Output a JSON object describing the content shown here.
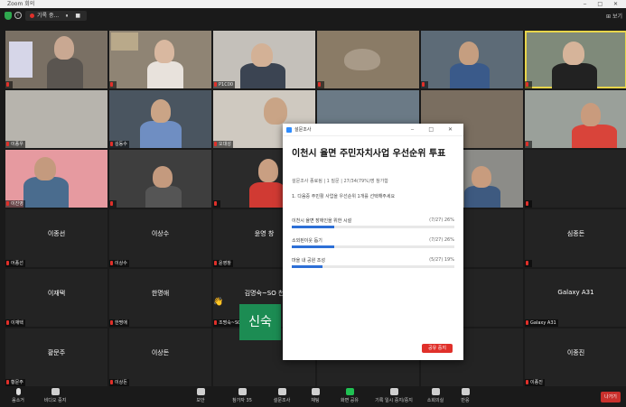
{
  "window": {
    "title": "Zoom 회의",
    "controls": "‒ □ ✕"
  },
  "topbar": {
    "recording_label": "기록 중...",
    "recording_controls": "⏸ ■",
    "view_label": "⊞ 보기"
  },
  "participants": [
    {
      "name": "",
      "label": "",
      "video": true
    },
    {
      "name": "",
      "label": "",
      "video": true
    },
    {
      "name": "",
      "label": "P1C00",
      "video": true
    },
    {
      "name": "",
      "label": "",
      "video": true
    },
    {
      "name": "",
      "label": "",
      "video": true
    },
    {
      "name": "",
      "label": "",
      "video": true
    },
    {
      "name": "",
      "label": "이종우",
      "video": true
    },
    {
      "name": "",
      "label": "김동수",
      "video": true
    },
    {
      "name": "",
      "label": "오대성",
      "video": true
    },
    {
      "name": "",
      "label": "",
      "video": true
    },
    {
      "name": "",
      "label": "",
      "video": true
    },
    {
      "name": "",
      "label": "",
      "video": true
    },
    {
      "name": "",
      "label": "이진영",
      "video": true
    },
    {
      "name": "",
      "label": "",
      "video": true
    },
    {
      "name": "",
      "label": "",
      "video": true
    },
    {
      "name": "",
      "label": "",
      "video": true
    },
    {
      "name": "",
      "label": "",
      "video": true
    },
    {
      "name": "",
      "label": "",
      "video": true
    },
    {
      "name": "이종선",
      "label": "어종선",
      "video": false
    },
    {
      "name": "이상수",
      "label": "이상수",
      "video": false
    },
    {
      "name": "윤영 창",
      "label": "윤영창",
      "video": false
    },
    {
      "name": "",
      "label": "",
      "video": false
    },
    {
      "name": "",
      "label": "",
      "video": false
    },
    {
      "name": "심종돈",
      "label": "",
      "video": false
    },
    {
      "name": "이재택",
      "label": "이재택",
      "video": false
    },
    {
      "name": "한명애",
      "label": "한명애",
      "video": false
    },
    {
      "name": "김명숙~SO 천",
      "label": "조명숙~SO 천호주",
      "video": false
    },
    {
      "name": "",
      "label": "",
      "video": false
    },
    {
      "name": "",
      "label": "",
      "video": false
    },
    {
      "name": "Galaxy A31",
      "label": "Galaxy A31",
      "video": false
    },
    {
      "name": "황문주",
      "label": "황문주",
      "video": false
    },
    {
      "name": "이상돈",
      "label": "이상돈",
      "video": false
    },
    {
      "name": "",
      "label": "",
      "video": false
    },
    {
      "name": "",
      "label": "",
      "video": false
    },
    {
      "name": "",
      "label": "",
      "video": false
    },
    {
      "name": "이종진",
      "label": "이종진",
      "video": false
    }
  ],
  "extra_tile_text": "신숙",
  "wave_emoji": "👋",
  "poll": {
    "window_title": "설문조사",
    "window_controls": "‒ □ ✕",
    "title": "이천시 율면 주민자치사업 우선순위 투표",
    "meta": "설문조사 종료됨 | 1 질문 | 27/34(79%)명 참가함",
    "question": "1. 다음중 주민활 사업을 우선순위 1개를 선택해주세요",
    "options": [
      {
        "label": "이천시 율면 장애인을 위한 시설",
        "percent": "(7/27) 26%",
        "fill": 0.26
      },
      {
        "label": "소외된이웃 돕기",
        "percent": "(7/27) 26%",
        "fill": 0.26
      },
      {
        "label": "마을 내 공원 조성",
        "percent": "(5/27) 19%",
        "fill": 0.19
      }
    ],
    "end_button": "공유 중지"
  },
  "toolbar": {
    "mute": "음소거",
    "video": "비디오 중지",
    "security": "보안",
    "participants": "참가자",
    "participants_count": "35",
    "polls": "설문조사",
    "chat": "채팅",
    "share": "화면 공유",
    "record": "기록 일시 중지/중지",
    "breakout": "소회의실",
    "reactions": "반응",
    "end": "나가기"
  }
}
